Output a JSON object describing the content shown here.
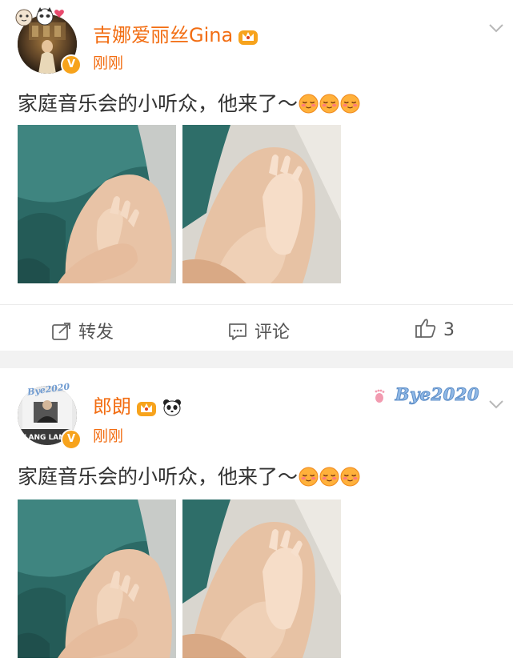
{
  "posts": [
    {
      "username": "吉娜爱丽丝Gina",
      "timestamp": "刚刚",
      "verified_badge": "V",
      "text": "家庭音乐会的小听众，他来了～",
      "emoji_count": 3,
      "emoji_icon": "content-face-emoji",
      "actions": {
        "repost_label": "转发",
        "comment_label": "评论",
        "like_count": "3"
      }
    },
    {
      "username": "郎朗",
      "timestamp": "刚刚",
      "verified_badge": "V",
      "avatar_sticker": "Bye2020",
      "avatar_caption": "LANG LANG",
      "sticker": "Bye2020",
      "text": "家庭音乐会的小听众，他来了～",
      "emoji_count": 3,
      "emoji_icon": "content-face-emoji"
    }
  ],
  "icons": {
    "repost": "repost-icon",
    "comment": "comment-icon",
    "like": "thumbs-up-icon",
    "more": "chevron-down-icon",
    "member": "crown-badge-icon",
    "panda": "panda-icon"
  },
  "colors": {
    "username": "#f26d12",
    "text": "#333333",
    "action": "#555555",
    "separator": "#f2f2f2",
    "verified": "#f7a31c",
    "sticker": "#8fb8e6"
  }
}
